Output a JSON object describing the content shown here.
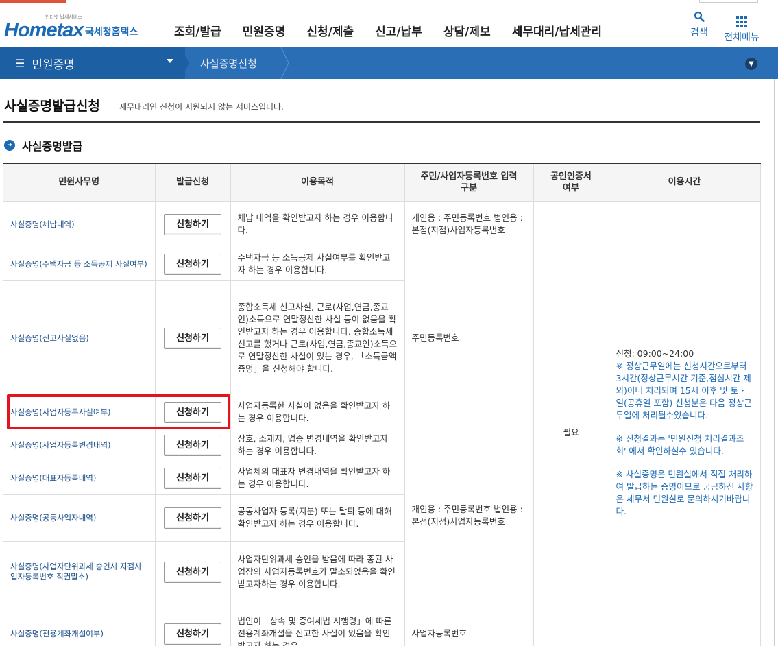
{
  "header": {
    "logo_tagline": "인터넷 납세서비스",
    "logo_text": "Hometax",
    "logo_kr": "국세청홈택스",
    "nav": [
      "조회/발급",
      "민원증명",
      "신청/제출",
      "신고/납부",
      "상담/제보",
      "세무대리/납세관리"
    ],
    "search_label": "검색",
    "menu_label": "전체메뉴"
  },
  "location": {
    "level1": "민원증명",
    "level2": "사실증명신청"
  },
  "page": {
    "title": "사실증명발급신청",
    "desc": "세무대리인 신청이 지원되지 않는 서비스입니다.",
    "section": "사실증명발급"
  },
  "table": {
    "headers": [
      "민원사무명",
      "발급신청",
      "이용목적",
      "주민/사업자등록번호 입력구분",
      "공인인증서 여부",
      "이용시간"
    ],
    "button_label": "신청하기",
    "cert_required": "필요",
    "rows": [
      {
        "name": "사실증명(체납내역)",
        "purpose": "체납 내역을 확인받고자 하는 경우 이용합니다."
      },
      {
        "name": "사실증명(주택자금 등 소득공제 사실여부)",
        "purpose": "주택자금 등 소득공제 사실여부를 확인받고자 하는 경우 이용합니다."
      },
      {
        "name": "사실증명(신고사실없음)",
        "purpose": "종합소득세 신고사실, 근로(사업,연금,종교인)소득으로 연말정산한 사실 등이 없음을 확인받고자 하는 경우 이용합니다. 종합소득세 신고를 했거나 근로(사업,연금,종교인)소득으로 연말정산한 사실이 있는 경우, 「소득금액증명」을 신청해야 합니다."
      },
      {
        "name": "사실증명(사업자등록사실여부)",
        "purpose": "사업자등록한 사실이 없음을 확인받고자 하는 경우 이용합니다."
      },
      {
        "name": "사실증명(사업자등록변경내역)",
        "purpose": "상호, 소재지, 업종 변경내역을 확인받고자 하는 경우 이용합니다."
      },
      {
        "name": "사실증명(대표자등록내역)",
        "purpose": "사업체의 대표자 변경내역을 확인받고자 하는 경우 이용합니다."
      },
      {
        "name": "사실증명(공동사업자내역)",
        "purpose": "공동사업자 등록(지분) 또는 탈퇴 등에 대해 확인받고자 하는 경우 이용합니다."
      },
      {
        "name": "사실증명(사업자단위과세 승인시 지점사업자등록번호 직권말소)",
        "purpose": "사업자단위과세 승인을 받음에 따라 종된 사업장의 사업자등록번호가 말소되었음을 확인받고자하는 경우 이용합니다."
      },
      {
        "name": "사실증명(전용계좌개설여부)",
        "purpose": "법인이「상속 및 증여세법 시행령」에 따른 전용계좌개설을 신고한 사실이 있음을 확인받고자 하는 경우"
      }
    ],
    "id_types": {
      "group1": "개인용 : 주민등록번호 법인용 : 본점(지점)사업자등록번호",
      "group2": "주민등록번호",
      "group3": "개인용 : 주민등록번호 법인용 : 본점(지점)사업자등록번호",
      "group4": "사업자등록번호"
    },
    "time": {
      "hours": "신청: 09:00~24:00",
      "note1": "※ 정상근무일에는 신청시간으로부터 3시간(정상근무시간 기준,점심시간 제외)이내 처리되며 15시 이후 및 토・일(공휴일 포함) 신청분은 다음 정상근무일에 처리될수있습니다.",
      "note2": "※ 신청결과는 '민원신청 처리결과조회' 에서 확인하실수 있습니다.",
      "note3": "※ 사실증명은 민원실에서 직접 처리하여 발급하는 증명이므로 궁금하신 사항은 세무서 민원실로 문의하시기바랍니다."
    }
  }
}
